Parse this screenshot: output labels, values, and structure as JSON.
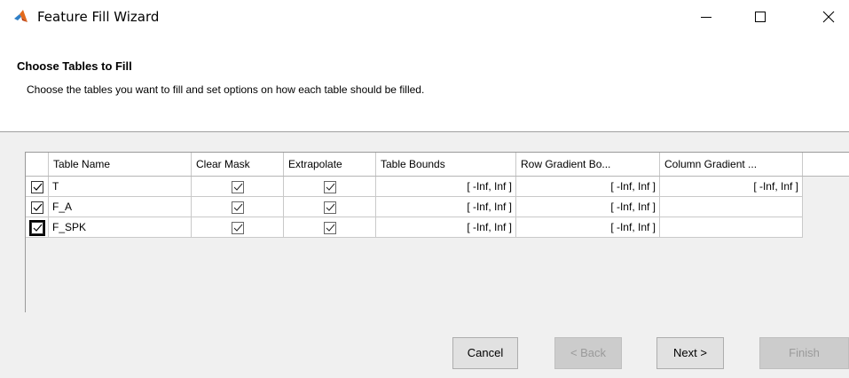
{
  "window": {
    "title": "Feature Fill Wizard"
  },
  "header": {
    "title": "Choose Tables to Fill",
    "description": "Choose the tables you want to fill and set options on how each table should be filled."
  },
  "table": {
    "columns": [
      "",
      "Table Name",
      "Clear Mask",
      "Extrapolate",
      "Table Bounds",
      "Row Gradient Bo...",
      "Column Gradient ..."
    ],
    "rows": [
      {
        "selected": true,
        "name": "T",
        "clear_mask": true,
        "extrapolate": true,
        "table_bounds": "[ -Inf, Inf ]",
        "row_gradient": "[ -Inf, Inf ]",
        "column_gradient": "[ -Inf, Inf ]"
      },
      {
        "selected": true,
        "name": "F_A",
        "clear_mask": true,
        "extrapolate": true,
        "table_bounds": "[ -Inf, Inf ]",
        "row_gradient": "[ -Inf, Inf ]",
        "column_gradient": ""
      },
      {
        "selected": true,
        "name": "F_SPK",
        "clear_mask": true,
        "extrapolate": true,
        "table_bounds": "[ -Inf, Inf ]",
        "row_gradient": "[ -Inf, Inf ]",
        "column_gradient": ""
      }
    ]
  },
  "buttons": {
    "cancel": "Cancel",
    "back": "< Back",
    "next": "Next >",
    "finish": "Finish"
  },
  "icons": {
    "app": "matlab-icon",
    "minimize": "minimize-icon",
    "maximize": "maximize-icon",
    "close": "close-icon",
    "check": "checkmark-icon"
  },
  "colors": {
    "body_bg": "#f0f0f0",
    "header_bg": "#ffffff",
    "button_bg": "#e1e1e1",
    "disabled_text": "#9a9a9a"
  }
}
